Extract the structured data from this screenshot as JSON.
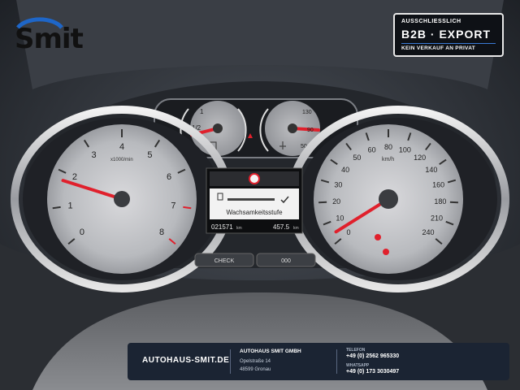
{
  "logo": {
    "name": "Smit"
  },
  "badge": {
    "line1": "AUSSCHLIESSLICH",
    "line2": "B2B · EXPORT",
    "line3": "KEIN VERKAUF AN PRIVAT"
  },
  "cluster": {
    "tacho": {
      "unit": "x1000/min",
      "ticks": [
        "0",
        "1",
        "2",
        "3",
        "4",
        "5",
        "6",
        "7",
        "8"
      ],
      "needle_value": 1.0
    },
    "speedo": {
      "unit": "km/h",
      "ticks": [
        "0",
        "10",
        "20",
        "30",
        "40",
        "50",
        "60",
        "80",
        "100",
        "120",
        "140",
        "160",
        "180",
        "210",
        "240"
      ],
      "needle_value": 0
    },
    "fuel": {
      "ticks": [
        "1/2",
        "1"
      ],
      "needle_value": 0.5
    },
    "temp": {
      "ticks": [
        "50",
        "90",
        "130"
      ],
      "needle_value": 90
    },
    "display": {
      "message": "Wachsamkeitsstufe",
      "odometer": "021571",
      "odo_unit": "km",
      "trip": "457.5",
      "trip_unit": "km"
    },
    "buttons": {
      "left": "CHECK",
      "right": "000"
    }
  },
  "footer": {
    "website": "AUTOHAUS-SMIT.DE",
    "company": "AUTOHAUS SMIT GMBH",
    "street": "Opelstraße 14",
    "city": "48599 Gronau",
    "phone_label": "TELEFON",
    "phone": "+49 (0) 2562 965330",
    "whatsapp_label": "WHATSAPP",
    "whatsapp": "+49 (0) 173 3030497"
  },
  "colors": {
    "needle": "#e0202c",
    "panel": "#1b2433",
    "accent": "#3a7bd5"
  }
}
